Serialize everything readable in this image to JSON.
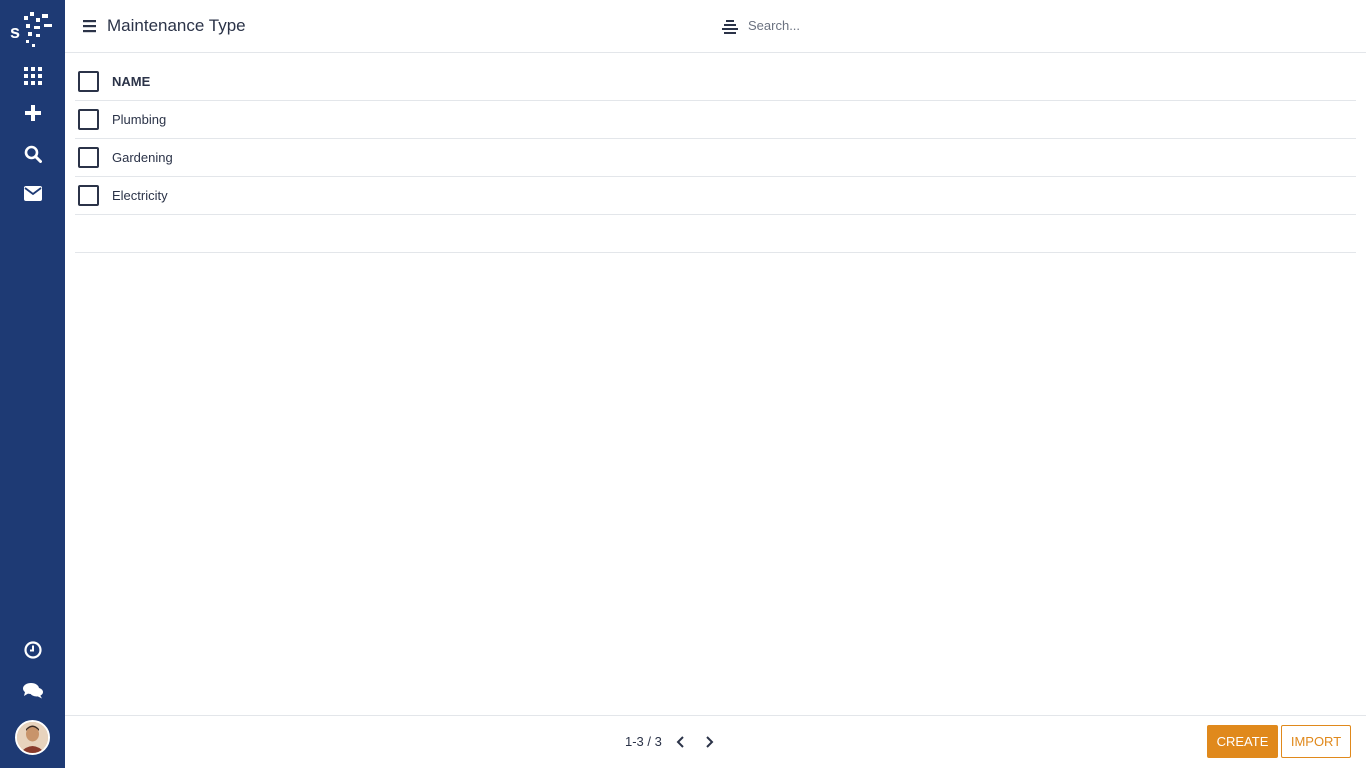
{
  "app": {
    "title": "Maintenance Type"
  },
  "search": {
    "placeholder": "Search...",
    "value": ""
  },
  "sidebar": {
    "items": [
      {
        "icon": "apps-grid-icon"
      },
      {
        "icon": "plus-icon"
      },
      {
        "icon": "search-icon"
      },
      {
        "icon": "mail-icon"
      },
      {
        "icon": "clock-icon"
      },
      {
        "icon": "chat-icon"
      }
    ]
  },
  "table": {
    "header": "NAME",
    "rows": [
      {
        "name": "Plumbing"
      },
      {
        "name": "Gardening"
      },
      {
        "name": "Electricity"
      }
    ]
  },
  "pagination": {
    "label": "1-3 / 3"
  },
  "actions": {
    "create": "CREATE",
    "import": "IMPORT"
  },
  "colors": {
    "sidebar": "#1e3a74",
    "accent": "#e0891c",
    "text": "#2b3348"
  }
}
